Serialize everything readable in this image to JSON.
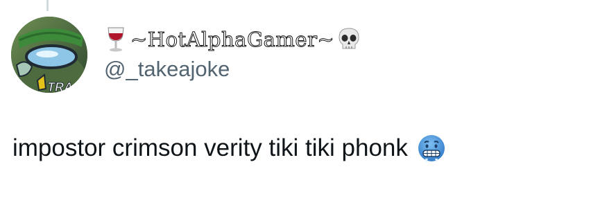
{
  "tweet": {
    "author": {
      "display_name": "~HotAlphaGamer~",
      "handle": "@_takeajoke",
      "avatar_text": "TRACK",
      "name_prefix_icon": "wine-glass-icon",
      "name_suffix_icon": "skull-icon"
    },
    "text": "impostor crimson verity tiki tiki phonk",
    "text_suffix_icon": "cold-face-icon"
  },
  "colors": {
    "handle": "#536471",
    "text": "#0f1419",
    "thread_line": "#cfd9de"
  }
}
